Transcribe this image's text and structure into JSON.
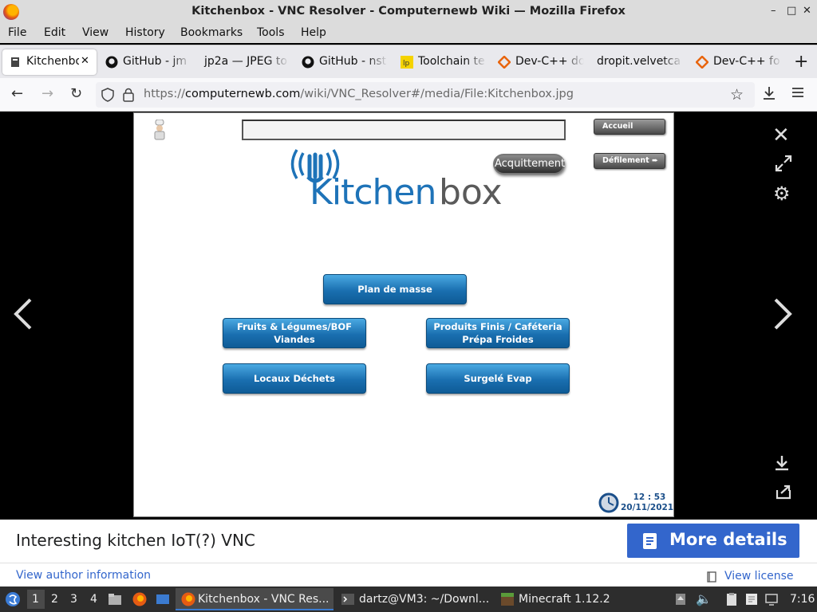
{
  "window": {
    "title": "Kitchenbox - VNC Resolver - Computernewb Wiki — Mozilla Firefox",
    "minimize": "–",
    "maximize": "□",
    "close": "✕"
  },
  "menu": [
    "File",
    "Edit",
    "View",
    "History",
    "Bookmarks",
    "Tools",
    "Help"
  ],
  "tabs": [
    {
      "label": "Kitchenbox",
      "icon": "page-icon"
    },
    {
      "label": "GitHub - jm",
      "icon": "github-icon"
    },
    {
      "label": "jp2a — JPEG to",
      "icon": ""
    },
    {
      "label": "GitHub - nst",
      "icon": "github-icon"
    },
    {
      "label": "Toolchain te",
      "icon": "lp-icon"
    },
    {
      "label": "Dev-C++ do",
      "icon": "devcpp-icon"
    },
    {
      "label": "dropit.velvetca",
      "icon": ""
    },
    {
      "label": "Dev-C++ fo",
      "icon": "devcpp-icon"
    }
  ],
  "tab_close": "✕",
  "new_tab": "+",
  "tab_overflow": "⌄",
  "url": {
    "prefix": "https://",
    "domain": "computernewb.com",
    "path": "/wiki/VNC_Resolver#/media/File:Kitchenbox.jpg"
  },
  "kitchenbox": {
    "logo_main": "Kitchen",
    "logo_sub": "box",
    "search_value": "",
    "accueil": "Accueil",
    "defilement": "Défilement",
    "acquittement": "Acquittement",
    "buttons": [
      {
        "line1": "Plan de masse",
        "line2": ""
      },
      {
        "line1": "Fruits & Légumes/BOF",
        "line2": "Viandes"
      },
      {
        "line1": "Produits Finis / Caféteria",
        "line2": "Prépa Froides"
      },
      {
        "line1": "Locaux Déchets",
        "line2": ""
      },
      {
        "line1": "Surgelé Evap",
        "line2": ""
      }
    ],
    "time": "12 : 53",
    "date": "20/11/2021"
  },
  "viewer": {
    "close_icon": "✕",
    "prev_icon": "‹",
    "next_icon": "›"
  },
  "caption": {
    "title": "Interesting kitchen IoT(?) VNC",
    "more_details": "More details",
    "author_link": "View author information",
    "license_link": "View license"
  },
  "taskbar": {
    "workspaces": [
      "1",
      "2",
      "3",
      "4"
    ],
    "windows": [
      "Kitchenbox - VNC Res...",
      "dartz@VM3: ~/Downl...",
      "Minecraft 1.12.2"
    ],
    "clock": "7:16"
  },
  "colors": {
    "accent": "#3366cc",
    "kitchen_blue": "#1e73b8",
    "box_gray": "#5a5a5a"
  }
}
